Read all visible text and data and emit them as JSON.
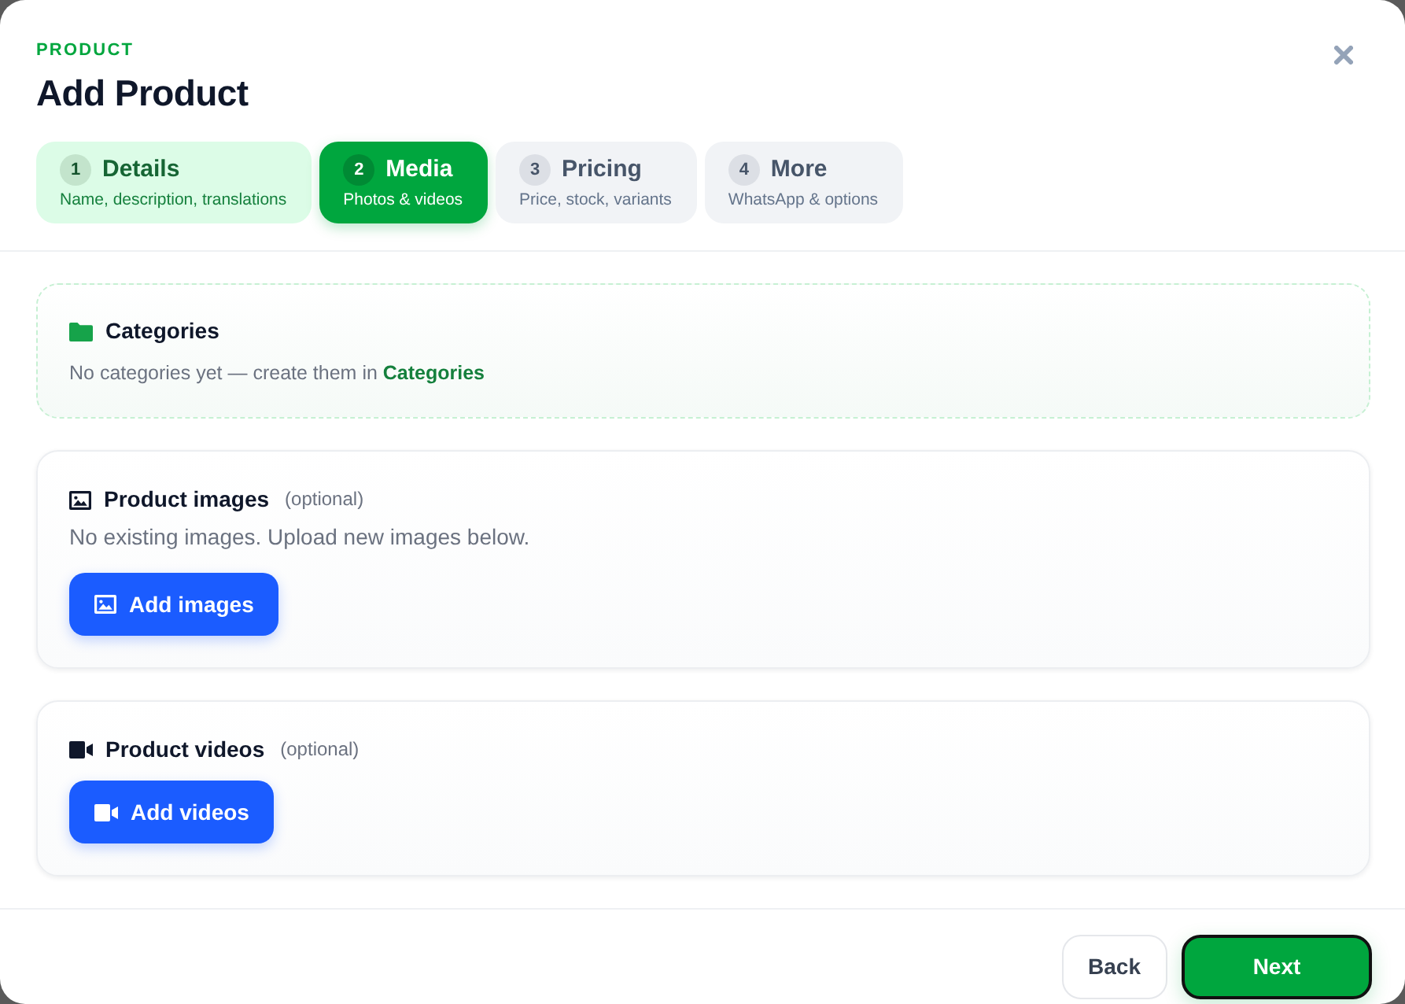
{
  "dialog": {
    "eyebrow": "PRODUCT",
    "title": "Add Product"
  },
  "steps": [
    {
      "number": "1",
      "title": "Details",
      "subtitle": "Name, description, translations",
      "selected": false,
      "completed": true
    },
    {
      "number": "2",
      "title": "Media",
      "subtitle": "Photos & videos",
      "selected": true,
      "completed": false
    },
    {
      "number": "3",
      "title": "Pricing",
      "subtitle": "Price, stock, variants",
      "selected": false,
      "completed": false
    },
    {
      "number": "4",
      "title": "More",
      "subtitle": "WhatsApp & options",
      "selected": false,
      "completed": false
    }
  ],
  "categories": {
    "title": "Categories",
    "text": "No categories yet — create them in ",
    "link": "Categories"
  },
  "sections": [
    {
      "kind": "images",
      "title": "Product images",
      "note": "(optional)",
      "text": "No existing images. Upload new images below.",
      "button": "Add images"
    },
    {
      "kind": "videos",
      "title": "Product videos",
      "note": "(optional)",
      "button": "Add videos"
    }
  ],
  "footer": {
    "buttons": [
      {
        "label": "Back",
        "kind": "secondary",
        "focused": false
      },
      {
        "label": "Next",
        "kind": "primary",
        "focused": true
      }
    ]
  }
}
